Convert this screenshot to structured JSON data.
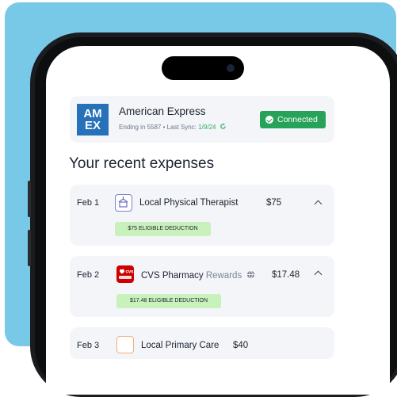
{
  "account": {
    "logo_text_top": "AM",
    "logo_text_bottom": "EX",
    "name": "American Express",
    "ending_label": "Ending in 5587 • Last Sync: ",
    "last_sync": "1/9/24",
    "status": "Connected"
  },
  "section_title": "Your recent expenses",
  "expenses": [
    {
      "date": "Feb 1",
      "merchant": "Local Physical Therapist",
      "merchant_suffix": "",
      "amount": "$75",
      "deduction": "$75 ELIGIBLE DEDUCTION",
      "icon": "building-icon"
    },
    {
      "date": "Feb 2",
      "merchant": "CVS Pharmacy ",
      "merchant_suffix": "Rewards",
      "amount": "$17.48",
      "deduction": "$17.48 ELIGIBLE DEDUCTION",
      "icon": "cvs-logo-icon"
    },
    {
      "date": "Feb 3",
      "merchant": "Local Primary Care",
      "merchant_suffix": "",
      "amount": "$40",
      "icon": "clinic-icon"
    }
  ],
  "colors": {
    "background": "#78c9e8",
    "accent_green": "#27a259",
    "badge_green": "#c9f1bc",
    "amex_blue": "#2671b9",
    "cvs_red": "#cc0000"
  }
}
